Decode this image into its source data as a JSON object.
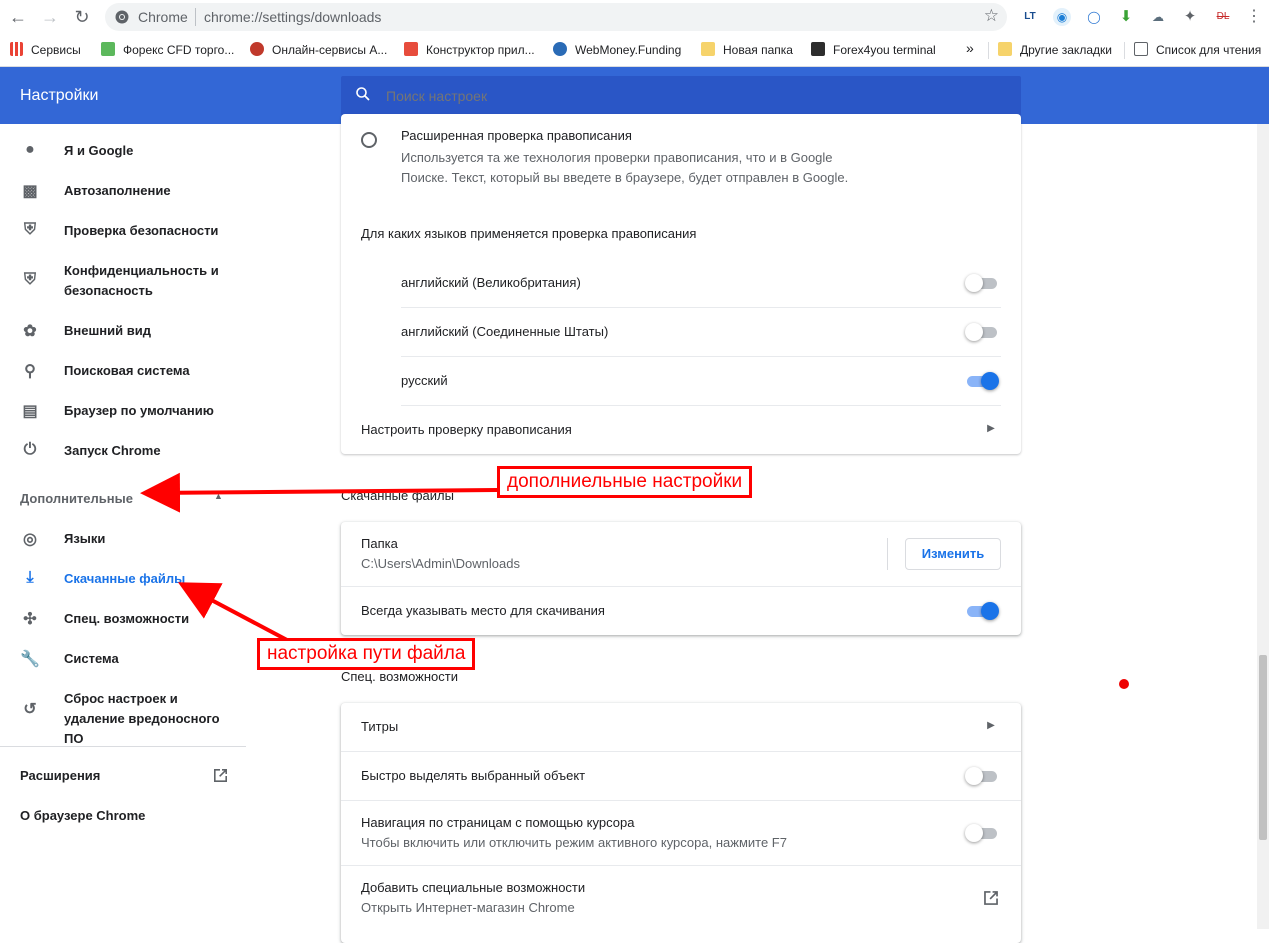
{
  "browser": {
    "site_name": "Chrome",
    "url": "chrome://settings/downloads"
  },
  "bookmarks": [
    {
      "label": "Сервисы",
      "icon": "apps-grid-icon"
    },
    {
      "label": "Форекс CFD торго...",
      "icon": "bookmark-favicon"
    },
    {
      "label": "Онлайн-сервисы А...",
      "icon": "bookmark-favicon"
    },
    {
      "label": "Конструктор прил...",
      "icon": "bookmark-favicon"
    },
    {
      "label": "WebMoney.Funding",
      "icon": "globe-icon"
    },
    {
      "label": "Новая папка",
      "icon": "folder-icon"
    },
    {
      "label": "Forex4you terminal",
      "icon": "bookmark-favicon"
    },
    {
      "label": "»",
      "icon": "chevron-more-icon"
    },
    {
      "label": "Другие закладки",
      "icon": "folder-icon"
    },
    {
      "label": "Список для чтения",
      "icon": "reading-list-icon"
    }
  ],
  "header": {
    "title": "Настройки",
    "search_placeholder": "Поиск настроек"
  },
  "sidebar": {
    "items": [
      {
        "label": "Я и Google",
        "icon": "person-icon"
      },
      {
        "label": "Автозаполнение",
        "icon": "clipboard-icon"
      },
      {
        "label": "Проверка безопасности",
        "icon": "shield-check-icon"
      },
      {
        "label": "Конфиденциальность и безопасность",
        "icon": "shield-icon"
      },
      {
        "label": "Внешний вид",
        "icon": "palette-icon"
      },
      {
        "label": "Поисковая система",
        "icon": "search-icon"
      },
      {
        "label": "Браузер по умолчанию",
        "icon": "browser-window-icon"
      },
      {
        "label": "Запуск Chrome",
        "icon": "power-icon"
      }
    ],
    "advanced_label": "Дополнительные",
    "advanced_items": [
      {
        "label": "Языки",
        "icon": "globe-icon"
      },
      {
        "label": "Скачанные файлы",
        "icon": "download-icon",
        "active": true
      },
      {
        "label": "Спец. возможности",
        "icon": "accessibility-icon"
      },
      {
        "label": "Система",
        "icon": "wrench-icon"
      },
      {
        "label": "Сброс настроек и удаление вредоносного ПО",
        "icon": "restore-icon"
      }
    ],
    "extensions_label": "Расширения",
    "about_label": "О браузере Chrome"
  },
  "spellcheck": {
    "enhanced_title": "Расширенная проверка правописания",
    "enhanced_desc": "Используется та же технология проверки правописания, что и в Google Поиске. Текст, который вы введете в браузере, будет отправлен в Google.",
    "languages_heading": "Для каких языков применяется проверка правописания",
    "languages": [
      {
        "label": "английский (Великобритания)",
        "enabled": false
      },
      {
        "label": "английский (Соединенные Штаты)",
        "enabled": false
      },
      {
        "label": "русский",
        "enabled": true
      }
    ],
    "customize_label": "Настроить проверку правописания"
  },
  "downloads": {
    "section_title": "Скачанные файлы",
    "folder_label": "Папка",
    "folder_path": "C:\\Users\\Admin\\Downloads",
    "change_button": "Изменить",
    "ask_location_label": "Всегда указывать место для скачивания",
    "ask_location_enabled": true
  },
  "accessibility": {
    "section_title": "Спец. возможности",
    "captions_label": "Титры",
    "focus_highlight_label": "Быстро выделять выбранный объект",
    "focus_highlight_enabled": false,
    "caret_label": "Навигация по страницам с помощью курсора",
    "caret_desc": "Чтобы включить или отключить режим активного курсора, нажмите F7",
    "caret_enabled": false,
    "add_features_label": "Добавить специальные возможности",
    "add_features_desc": "Открыть Интернет-магазин Chrome"
  },
  "annotations": {
    "advanced_callout": "дополниельные настройки",
    "path_callout": "настройка пути файла"
  },
  "colors": {
    "header_blue": "#3367d6",
    "accent": "#1a73e8",
    "annotation_red": "#ff0000"
  }
}
